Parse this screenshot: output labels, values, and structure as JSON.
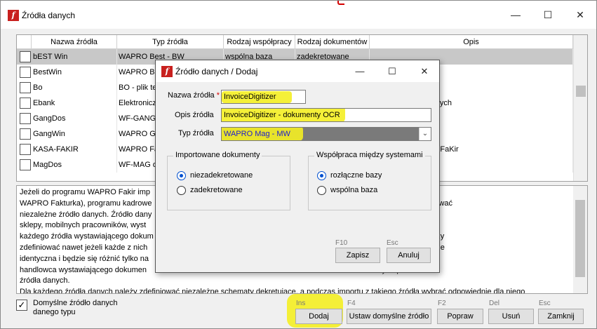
{
  "window": {
    "title": "Źródła danych",
    "icon_glyph": "f",
    "minimize_icon": "minimize-icon",
    "maximize_icon": "maximize-icon",
    "close_icon": "close-icon"
  },
  "table": {
    "columns": [
      "Nazwa źródła",
      "Typ źródła",
      "Rodzaj współpracy",
      "Rodzaj dokumentów",
      "Opis"
    ],
    "rows": [
      {
        "name": "bEST Win",
        "type": "WAPRO Best - BW",
        "cooperation": "wspólna baza",
        "documents": "zadekretowane",
        "description": "",
        "checked": false,
        "selected": true
      },
      {
        "name": "BestWin",
        "type": "WAPRO Be",
        "cooperation": "",
        "documents": "",
        "description": "",
        "checked": false,
        "selected": false
      },
      {
        "name": "Bo",
        "type": "BO - plik tek",
        "cooperation": "",
        "documents": "",
        "description": "",
        "checked": false,
        "selected": false
      },
      {
        "name": "Ebank",
        "type": "Elektroniczn",
        "cooperation": "",
        "documents": "",
        "description": "h wyciągów bankowych",
        "checked": false,
        "selected": false
      },
      {
        "name": "GangDos",
        "type": "WF-GANG",
        "cooperation": "",
        "documents": "",
        "description": "",
        "checked": false,
        "selected": false
      },
      {
        "name": "GangWin",
        "type": "WAPRO Ga",
        "cooperation": "",
        "documents": "",
        "description": "",
        "checked": false,
        "selected": false
      },
      {
        "name": "KASA-FAKIR",
        "type": "WAPRO Fa",
        "cooperation": "",
        "documents": "",
        "description": "Kasy programu WF-FaKir",
        "checked": false,
        "selected": false
      },
      {
        "name": "MagDos",
        "type": "WF-MAG d",
        "cooperation": "",
        "documents": "",
        "description": "",
        "checked": false,
        "selected": false
      }
    ]
  },
  "description_lines": [
    "Jeżeli do programu WAPRO Fakir imp                                                                                    o WAPRO (WAPRO Mag lub",
    "WAPRO Fakturka), programu kadrowe                                                                                     każdego z nich należy zdefiniować",
    "niezależne źródło danych. Źródło dany                                                                                 ch. Jeżeli firma ma oddziały, filie,",
    "sklepy, mobilnych pracowników, wyst                                                                                   finansowo - księgowego, dla",
    "każdego źródła wystawiającego dokum                                                                                   Niezależne źródło danych należy",
    "zdefiniować nawet jeżeli każde z nich                                                                                  aksięgowania, czyli definicja będzie",
    "identyczna i będzie się różnić tylko na                                                                                ramów WAPRO Mag i jednego",
    "handlowca wystawiającego dokumen                                                                                      zdefiniować trzy odpowiednie",
    "źródła danych.",
    "Dla każdego źródła danych należy zdefiniować niezależne schematy dekretujące, a podczas importu z takiego źródła wybrać odpowiednie dla niego"
  ],
  "bottom": {
    "default_checkbox_label": "Domyślne źródło danych danego typu",
    "default_checked": true,
    "buttons": [
      {
        "hotkey": "Ins",
        "label": "Dodaj"
      },
      {
        "hotkey": "F4",
        "label": "Ustaw domyślne źródło"
      },
      {
        "hotkey": "F2",
        "label": "Popraw"
      },
      {
        "hotkey": "Del",
        "label": "Usuń"
      },
      {
        "hotkey": "Esc",
        "label": "Zamknij"
      }
    ]
  },
  "dialog": {
    "title": "Źródło danych / Dodaj",
    "name_label": "Nazwa źródła",
    "required_mark": "*",
    "name_value": "InvoiceDigitizer",
    "desc_label": "Opis źródła",
    "desc_value": "InvoiceDigitizer - dokumenty OCR",
    "type_label": "Typ źródła",
    "type_value": "WAPRO Mag - MW",
    "imported_group": {
      "title": "Importowane dokumenty",
      "options": [
        {
          "label": "niezadekretowane",
          "selected": true
        },
        {
          "label": "zadekretowane",
          "selected": false
        }
      ]
    },
    "cooperation_group": {
      "title": "Współpraca między systemami",
      "options": [
        {
          "label": "rozłączne bazy",
          "selected": true
        },
        {
          "label": "wspólna baza",
          "selected": false
        }
      ]
    },
    "save_hotkey": "F10",
    "save_label": "Zapisz",
    "cancel_hotkey": "Esc",
    "cancel_label": "Anuluj"
  },
  "colors": {
    "highlight": "#f4ee22",
    "selected_row": "#c8c8c8",
    "app_icon": "#c8201e",
    "radio_accent": "#0050d0",
    "annotation_red": "#d40000"
  }
}
